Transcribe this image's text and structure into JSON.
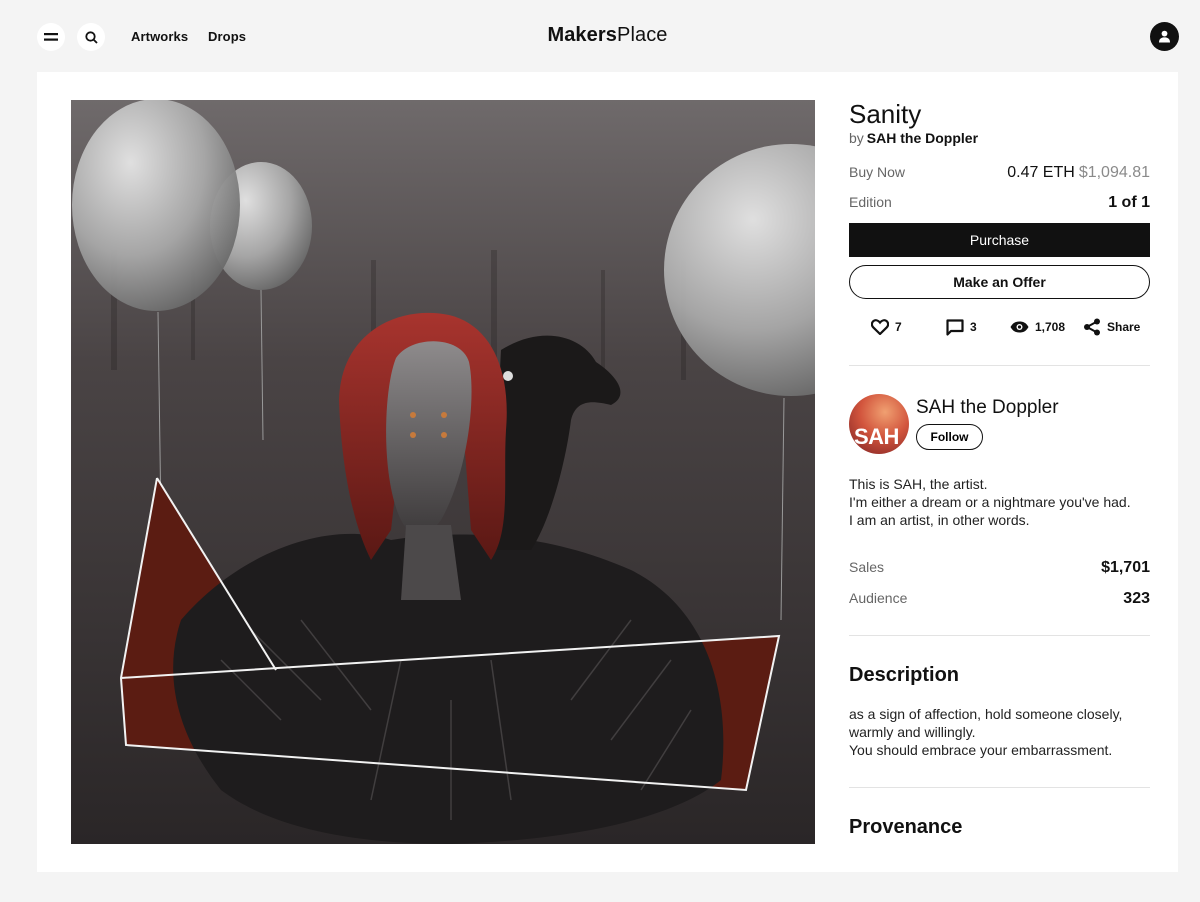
{
  "nav": {
    "logo_bold": "Makers",
    "logo_regular": "Place",
    "links": [
      "Artworks",
      "Drops"
    ],
    "icons": [
      "menu-icon",
      "search-icon",
      "user-icon"
    ]
  },
  "artwork": {
    "title": "Sanity",
    "by_prefix": "by",
    "artist": "SAH the Doppler",
    "buy_label": "Buy Now",
    "price_eth": "0.47 ETH",
    "price_usd": "$1,094.81",
    "edition_label": "Edition",
    "edition_value": "1 of 1",
    "purchase_label": "Purchase",
    "offer_label": "Make an Offer"
  },
  "stats": {
    "likes": "7",
    "comments": "3",
    "views": "1,708",
    "share_label": "Share"
  },
  "creator": {
    "name": "SAH the Doppler",
    "avatar_text": "SAH",
    "follow_label": "Follow",
    "bio": [
      "This is SAH, the artist.",
      "I'm either a dream or a nightmare you've had.",
      "I am an artist, in other words."
    ],
    "sales_label": "Sales",
    "sales_value": "$1,701",
    "audience_label": "Audience",
    "audience_value": "323"
  },
  "description": {
    "title": "Description",
    "lines": [
      "as a sign of affection, hold someone closely,",
      "warmly and willingly.",
      "You should embrace your embarrassment."
    ]
  },
  "provenance": {
    "title": "Provenance"
  },
  "colors": {
    "accent": "#111111",
    "muted": "#666666",
    "page_bg": "#f4f4f4"
  }
}
